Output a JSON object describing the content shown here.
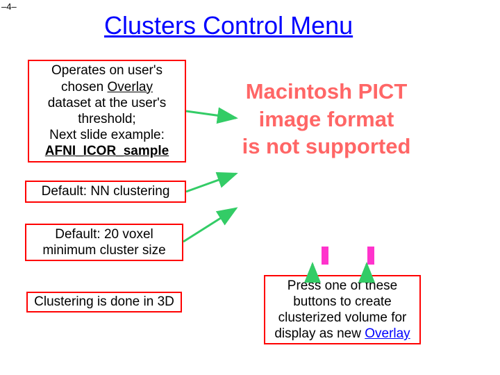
{
  "slide": {
    "number": "–4–",
    "title": "Clusters Control Menu"
  },
  "boxes": {
    "b1": {
      "line1": "Operates on user's",
      "line2a": "chosen ",
      "line2b": "Overlay",
      "line3": "dataset at the user's",
      "line4": "threshold;",
      "line5": "Next slide example:",
      "line6": "AFNI_ICOR_sample"
    },
    "b2": {
      "text": "Default: NN clustering"
    },
    "b3": {
      "line1": "Default: 20 voxel",
      "line2": "minimum cluster size"
    },
    "b4": {
      "text": "Clustering is done in 3D"
    },
    "b5": {
      "line1": "Press one of these",
      "line2": "buttons to create",
      "line3": "clusterized volume for",
      "line4a": "display as new ",
      "line4b": "Overlay"
    }
  },
  "pict": {
    "line1": "Macintosh PICT",
    "line2": "image format",
    "line3": "is not supported"
  }
}
